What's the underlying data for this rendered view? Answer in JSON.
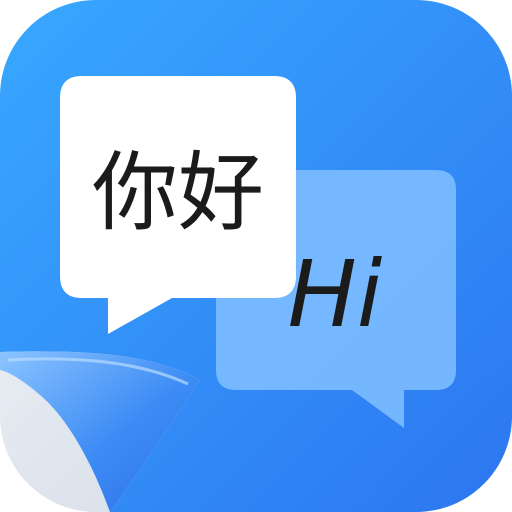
{
  "app_icon": {
    "name": "translate-app-icon",
    "colors": {
      "background_light": "#35A3FF",
      "background_dark": "#2E7BF1",
      "bubble_front": "#FFFFFF",
      "bubble_back": "#7BBCFF",
      "text": "#1B1B1B",
      "page_curl": "#DCE5F0"
    },
    "source_bubble": {
      "text": "你好"
    },
    "target_bubble": {
      "text": "Hi"
    }
  }
}
